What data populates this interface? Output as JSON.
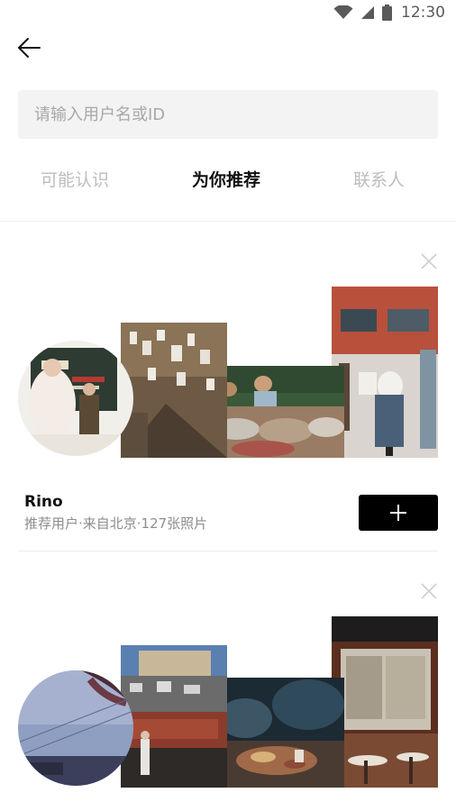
{
  "status_bar": {
    "time": "12:30"
  },
  "search": {
    "placeholder": "请输入用户名或ID"
  },
  "tabs": [
    {
      "label": "可能认识",
      "active": false
    },
    {
      "label": "为你推荐",
      "active": true
    },
    {
      "label": "联系人",
      "active": false
    }
  ],
  "recommendations": [
    {
      "name": "Rino",
      "meta": "推荐用户·来自北京·127张照片",
      "photos": [
        "avatar-gallery-portrait",
        "street-notes-alley",
        "fish-market",
        "nuns-street"
      ]
    },
    {
      "name": "",
      "meta": "",
      "photos": [
        "avatar-sky-shadow",
        "city-street-bw",
        "food-glass-table",
        "bakery-storefront"
      ]
    }
  ],
  "colors": {
    "accent": "#000000",
    "muted_text": "#8d8d8d",
    "inactive_tab": "#bdbdbd",
    "search_bg": "#f3f3f3"
  }
}
